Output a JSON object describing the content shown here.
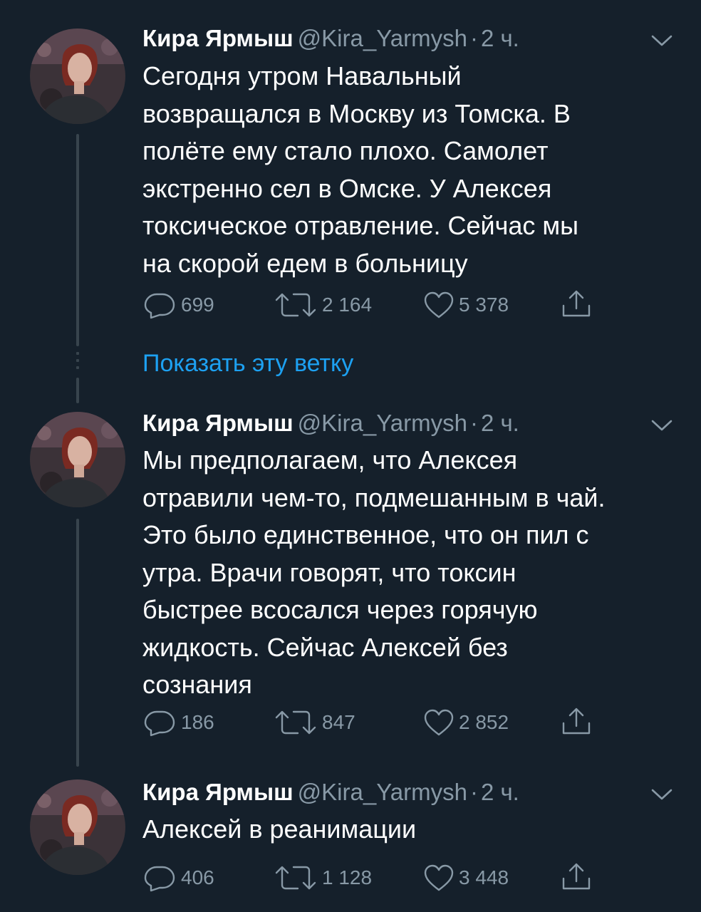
{
  "author": {
    "name": "Кира Ярмыш",
    "handle": "@Kira_Yarmysh",
    "separator": "·"
  },
  "show_thread_label": "Показать эту ветку",
  "colors": {
    "background": "#15202b",
    "text": "#ffffff",
    "muted": "#8899a6",
    "link": "#1da1f2",
    "thread_line": "#38444d"
  },
  "icons": {
    "reply": "reply-icon",
    "retweet": "retweet-icon",
    "like": "like-icon",
    "share": "share-icon",
    "caret": "chevron-down-icon"
  },
  "tweets": [
    {
      "time": "2 ч.",
      "text": "Сегодня утром Навальный\nвозвращался в Москву из Томска. В\nполёте ему стало плохо. Самолет\nэкстренно сел в Омске. У Алексея\nтоксическое отравление. Сейчас мы\nна скорой едем в больницу",
      "replies": "699",
      "retweets": "2 164",
      "likes": "5 378"
    },
    {
      "time": "2 ч.",
      "text": "Мы предполагаем, что Алексея\nотравили чем-то, подмешанным в чай.\nЭто было единственное, что он пил с\nутра. Врачи говорят, что токсин\nбыстрее всосался через горячую\nжидкость. Сейчас Алексей без\nсознания",
      "replies": "186",
      "retweets": "847",
      "likes": "2 852"
    },
    {
      "time": "2 ч.",
      "text": "Алексей в реанимации",
      "replies": "406",
      "retweets": "1 128",
      "likes": "3 448"
    }
  ]
}
